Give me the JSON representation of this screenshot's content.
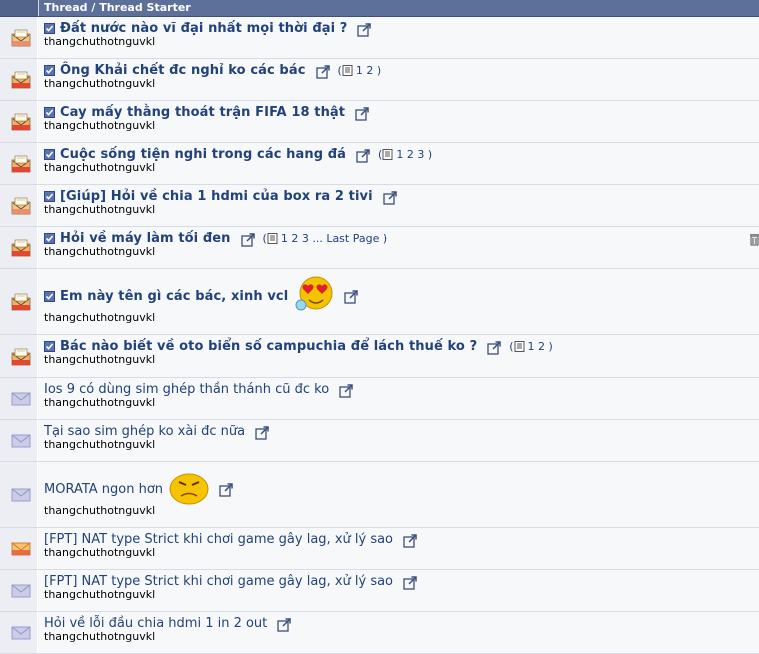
{
  "header": {
    "title": "Thread / Thread Starter"
  },
  "threads": [
    {
      "title": "Đất nước nào vĩ đại nhất mọi thời đại ?",
      "starter": "thangchuthotnguvkl",
      "bold": true,
      "icon": "hot-folder-icon",
      "pages": null
    },
    {
      "title": "Ông Khải chết đc nghỉ ko các bác",
      "starter": "thangchuthotnguvkl",
      "bold": true,
      "icon": "hot-new-folder-icon",
      "pages": "1 2"
    },
    {
      "title": "Cay mấy thằng thoát trận FIFA 18 thật",
      "starter": "thangchuthotnguvkl",
      "bold": true,
      "icon": "hot-new-folder-icon",
      "pages": null
    },
    {
      "title": "Cuộc sống tiện nghi trong các hang đá",
      "starter": "thangchuthotnguvkl",
      "bold": true,
      "icon": "hot-new-folder-icon",
      "pages": "1 2 3"
    },
    {
      "title": "[Giúp] Hỏi về chia 1 hdmi của box ra 2 tivi",
      "starter": "thangchuthotnguvkl",
      "bold": true,
      "icon": "hot-folder-icon",
      "pages": null
    },
    {
      "title": "Hỏi về máy làm tối đen",
      "starter": "thangchuthotnguvkl",
      "bold": true,
      "icon": "hot-new-folder-icon",
      "pages": "1 2 3 ... Last Page"
    },
    {
      "title": "Em này tên gì các bác, xinh vcl",
      "starter": "thangchuthotnguvkl",
      "bold": true,
      "icon": "hot-new-folder-icon",
      "pages": null
    },
    {
      "title": "Bác nào biết về oto biển số campuchia để lách thuế ko ?",
      "starter": "thangchuthotnguvkl",
      "bold": true,
      "icon": "hot-new-folder-icon",
      "pages": "1 2"
    },
    {
      "title": "Ios 9 có dùng sim ghép thần thánh cũ đc ko",
      "starter": "thangchuthotnguvkl",
      "bold": false,
      "icon": "closed-envelope-icon",
      "pages": null
    },
    {
      "title": "Tại sao sim ghép ko xài đc nữa",
      "starter": "thangchuthotnguvkl",
      "bold": false,
      "icon": "closed-envelope-icon",
      "pages": null
    },
    {
      "title": "MORATA ngon hơn",
      "starter": "thangchuthotnguvkl",
      "bold": false,
      "icon": "closed-envelope-icon",
      "pages": null
    },
    {
      "title": "[FPT] NAT type Strict khi chơi game gây lag, xử lý sao",
      "starter": "thangchuthotnguvkl",
      "bold": false,
      "icon": "hot-envelope-icon",
      "pages": null
    },
    {
      "title": "[FPT] NAT type Strict khi chơi game gây lag, xử lý sao",
      "starter": "thangchuthotnguvkl",
      "bold": false,
      "icon": "closed-envelope-icon",
      "pages": null
    },
    {
      "title": "Hỏi về lỗi đầu chia hdmi 1 in 2 out",
      "starter": "thangchuthotnguvkl",
      "bold": false,
      "icon": "closed-envelope-icon",
      "pages": null
    }
  ],
  "colors": {
    "header_bg": "#5c7099",
    "link": "#22427a",
    "icon_col": "#eceef3"
  }
}
